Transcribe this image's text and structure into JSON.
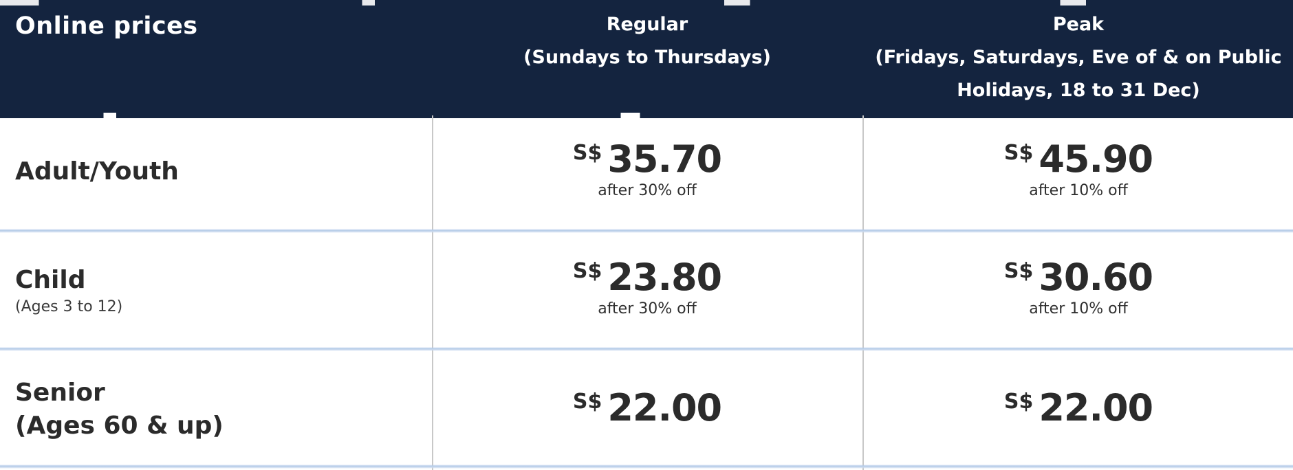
{
  "table": {
    "header": {
      "first": "Online prices",
      "regular_line1": "Regular",
      "regular_line2": "(Sundays to Thursdays)",
      "peak_line1": "Peak",
      "peak_line2": "(Fridays, Saturdays, Eve of & on Public",
      "peak_line3": "Holidays, 18 to 31 Dec)"
    },
    "currency": "S$",
    "rows": [
      {
        "label": "Adult/Youth",
        "sublabel": "",
        "regular_price": "35.70",
        "regular_note": "after 30% off",
        "peak_price": "45.90",
        "peak_note": "after 10% off"
      },
      {
        "label": "Child",
        "sublabel": "(Ages 3 to 12)",
        "regular_price": "23.80",
        "regular_note": "after 30% off",
        "peak_price": "30.60",
        "peak_note": "after 10% off"
      },
      {
        "label": "Senior",
        "label_line2": "(Ages 60 & up)",
        "regular_price": "22.00",
        "regular_note": "",
        "peak_price": "22.00",
        "peak_note": ""
      }
    ]
  },
  "colors": {
    "header_bg": "#14243f",
    "header_text": "#ffffff",
    "body_text": "#2b2b2b",
    "row_divider": "#b5cbe8",
    "column_divider": "#c8c8c8"
  }
}
